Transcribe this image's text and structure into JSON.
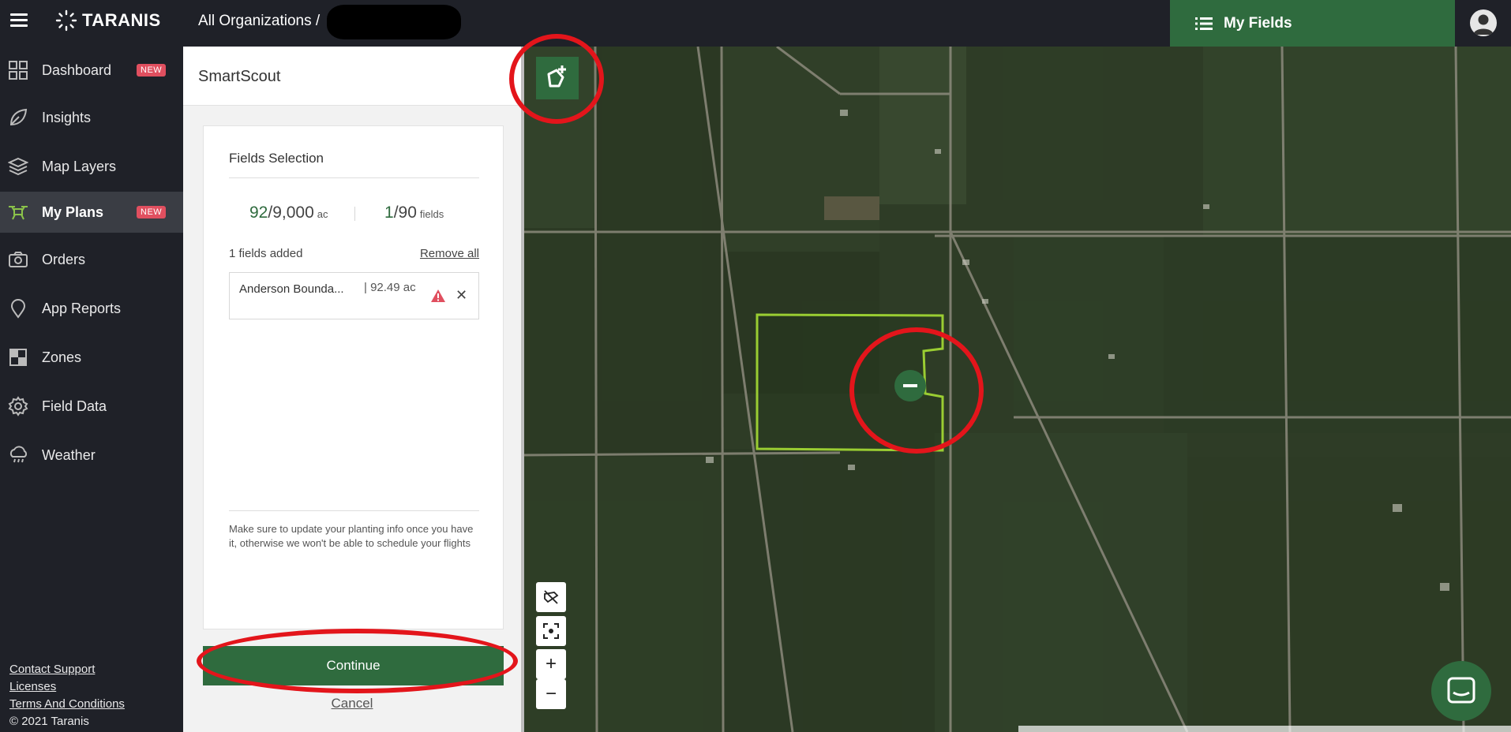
{
  "topbar": {
    "logo_text": "TARANIS",
    "breadcrumb": "All Organizations /",
    "my_fields_label": "My Fields"
  },
  "sidebar": {
    "items": [
      {
        "label": "Dashboard",
        "badge": "NEW",
        "icon": "grid-icon"
      },
      {
        "label": "Insights",
        "icon": "leaf-icon"
      },
      {
        "label": "Map Layers",
        "icon": "layers-icon"
      },
      {
        "label": "My Plans",
        "badge": "NEW",
        "icon": "drone-icon",
        "active": true
      },
      {
        "label": "Orders",
        "icon": "camera-icon"
      },
      {
        "label": "App Reports",
        "icon": "location-pin-icon"
      },
      {
        "label": "Zones",
        "icon": "checkerboard-icon"
      },
      {
        "label": "Field Data",
        "icon": "gear-icon"
      },
      {
        "label": "Weather",
        "icon": "cloud-rain-icon"
      }
    ],
    "footer": {
      "contact_support": "Contact Support",
      "licenses": "Licenses",
      "terms": "Terms And Conditions",
      "copyright": "© 2021 Taranis"
    }
  },
  "panel": {
    "title": "SmartScout",
    "card_title": "Fields Selection",
    "acres_selected": "92",
    "acres_total": "/9,000",
    "acres_unit": "ac",
    "fields_selected": "1",
    "fields_total": "/90",
    "fields_unit": "fields",
    "fields_added": "1 fields added",
    "remove_all": "Remove all",
    "field_item": {
      "name": "Anderson Bounda...",
      "acres": "| 92.49 ac"
    },
    "note": "Make sure to update your planting info once you have it, otherwise we won't be able to schedule your flights",
    "continue_label": "Continue",
    "cancel_label": "Cancel"
  },
  "map": {
    "zoom_in": "+",
    "zoom_out": "−",
    "field_outline_color": "#9acd32"
  },
  "colors": {
    "brand_green": "#2f6b3e",
    "badge_red": "#e04f5f",
    "annotation_red": "#e3151b"
  }
}
